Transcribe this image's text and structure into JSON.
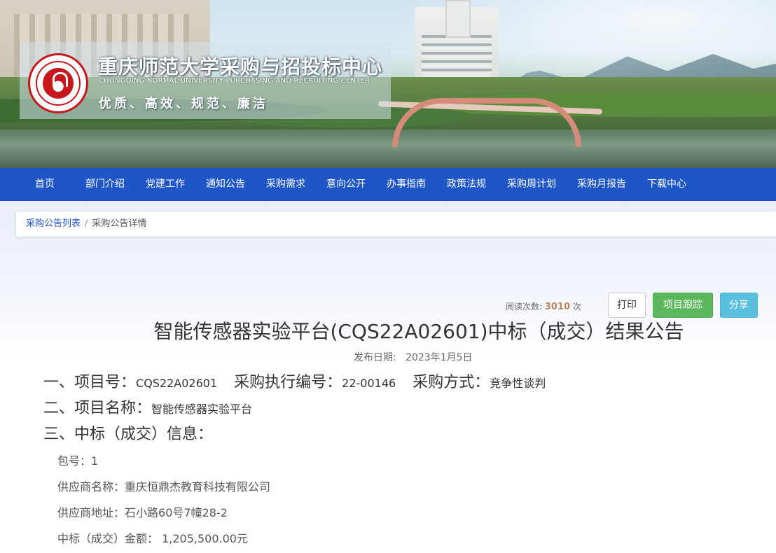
{
  "header": {
    "title": "重庆师范大学采购与招投标中心",
    "subtitle": "CHONGQING NORMAL UNIVERSITY PURCHASING AND RECRUITING CENTER",
    "motto": "优质、高效、规范、廉洁",
    "logo_icon": "university-seal-icon"
  },
  "nav": {
    "items": [
      {
        "label": "首页"
      },
      {
        "label": "部门介绍"
      },
      {
        "label": "党建工作"
      },
      {
        "label": "通知公告"
      },
      {
        "label": "采购需求"
      },
      {
        "label": "意向公开"
      },
      {
        "label": "办事指南"
      },
      {
        "label": "政策法规"
      },
      {
        "label": "采购周计划"
      },
      {
        "label": "采购月报告"
      },
      {
        "label": "下载中心"
      }
    ]
  },
  "breadcrumb": {
    "parent": "采购公告列表",
    "separator": "/",
    "current": "采购公告详情"
  },
  "stats": {
    "read_label": "阅读次数:",
    "read_count": "3010",
    "read_unit": "次"
  },
  "actions": {
    "print": "打印",
    "track": "项目跟踪",
    "share": "分享"
  },
  "article": {
    "title": "智能传感器实验平台(CQS22A02601)中标（成交）结果公告",
    "publish_label": "发布日期:",
    "publish_date": "2023年1月5日",
    "section1": {
      "label_no": "一、项目号：",
      "project_no": "CQS22A02601",
      "label_exec": "采购执行编号：",
      "exec_no": "22-00146",
      "label_method": "采购方式：",
      "method": "竞争性谈判"
    },
    "section2": {
      "label": "二、项目名称：",
      "name": "智能传感器实验平台"
    },
    "section3": {
      "label": "三、中标（成交）信息："
    },
    "package": {
      "label": "包号：",
      "value": "1"
    },
    "supplier_name": {
      "label": "供应商名称：",
      "value": "重庆恒鼎杰教育科技有限公司"
    },
    "supplier_address": {
      "label": "供应商地址：",
      "value": "石小路60号7幢28-2"
    },
    "amount": {
      "label": "中标（成交）金额：",
      "value": "1,205,500.00元"
    }
  },
  "colors": {
    "nav_bg": "#1f56c7",
    "track_btn": "#5cb85c",
    "share_btn": "#5bc0de",
    "logo_red": "#c8161d"
  }
}
